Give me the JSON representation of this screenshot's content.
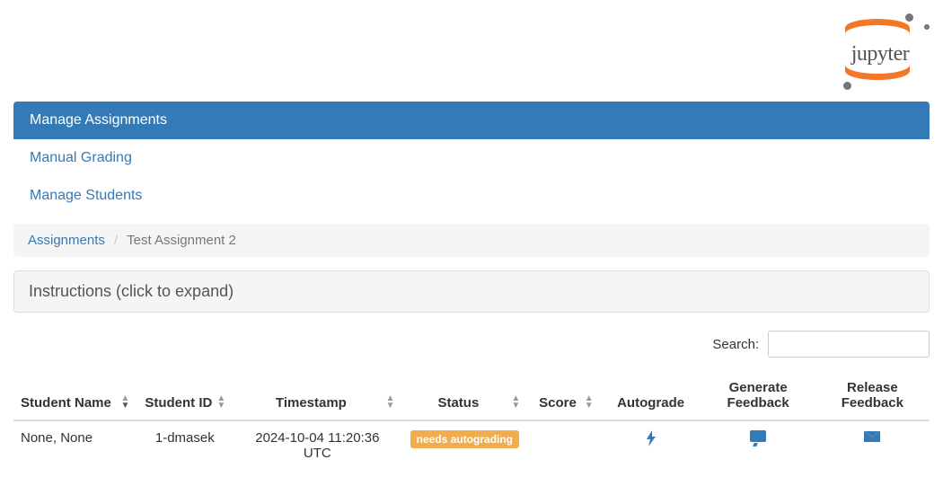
{
  "header": {
    "logo_text": "jupyter"
  },
  "nav": {
    "items": [
      {
        "label": "Manage Assignments",
        "active": true
      },
      {
        "label": "Manual Grading",
        "active": false
      },
      {
        "label": "Manage Students",
        "active": false
      }
    ]
  },
  "breadcrumb": {
    "root": "Assignments",
    "current": "Test Assignment 2"
  },
  "instructions": {
    "label": "Instructions (click to expand)"
  },
  "search": {
    "label": "Search:",
    "value": ""
  },
  "table": {
    "columns": {
      "student_name": "Student Name",
      "student_id": "Student ID",
      "timestamp": "Timestamp",
      "status": "Status",
      "score": "Score",
      "autograde": "Autograde",
      "generate_feedback": "Generate Feedback",
      "release_feedback": "Release Feedback"
    },
    "rows": [
      {
        "student_name": "None, None",
        "student_id": "1-dmasek",
        "timestamp": "2024-10-04 11:20:36 UTC",
        "status": "needs autograding",
        "score": "",
        "autograde_icon": "lightning-icon",
        "generate_icon": "comment-icon",
        "release_icon": "envelope-icon"
      }
    ]
  }
}
